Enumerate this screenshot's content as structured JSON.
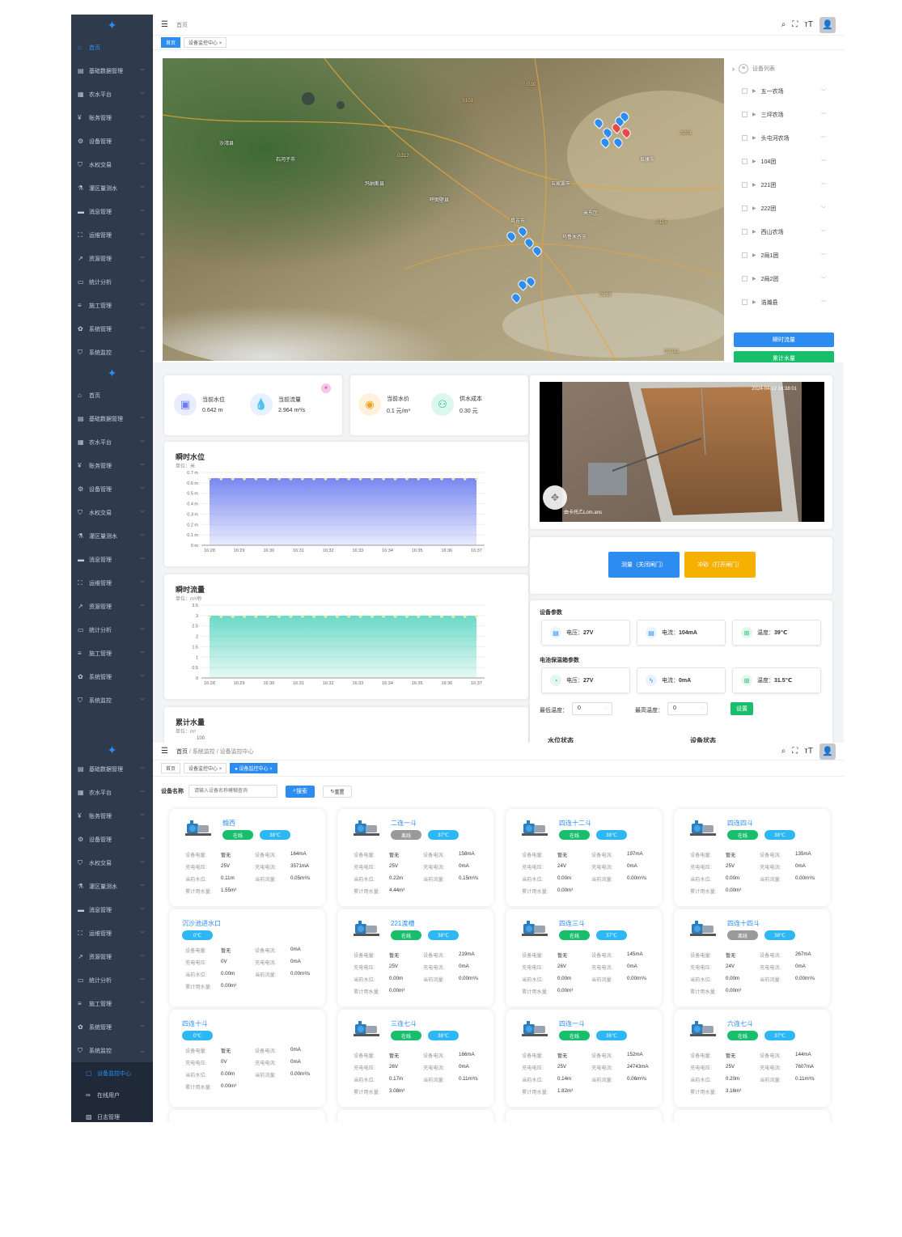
{
  "sidebar_menu": [
    "基础数据管理",
    "农水平台",
    "账务管理",
    "设备管理",
    "水权交易",
    "灌区量测水",
    "消息管理",
    "运维管理",
    "资源管理",
    "统计分析",
    "施工管理",
    "系统管理",
    "系统监控"
  ],
  "sidebar_home": "首页",
  "sidebar_sub": [
    "设备监控中心",
    "在线用户",
    "日志管理"
  ],
  "s1": {
    "crumb": "首页",
    "tags": [
      "首页",
      "设备监控中心"
    ],
    "device_list_title": "设备列表",
    "device_list": [
      "五一农场",
      "三坪农场",
      "头屯河农场",
      "104团",
      "221团",
      "222团",
      "西山农场",
      "2局1团",
      "2局2团",
      "浩瀚县"
    ],
    "btn_flow": "瞬时流量",
    "btn_total": "累计水量",
    "map_labels": [
      "乌鲁木齐市",
      "昌吉市",
      "五家渠市",
      "阜康市",
      "米东区",
      "呼图壁县",
      "玛纳斯县",
      "石河子市",
      "沙湾县",
      "G312",
      "G30",
      "G216",
      "S101",
      "S115",
      "S201",
      "G3033"
    ]
  },
  "s2": {
    "metrics": [
      {
        "label": "当前水位",
        "value": "0.642 m"
      },
      {
        "label": "当前流量",
        "value": "2.964 m³/s"
      },
      {
        "label": "当前水价",
        "value": "0.1 元/m³"
      },
      {
        "label": "供水成本",
        "value": "0.30 元"
      }
    ],
    "video_timestamp": "2024-04-12 16:38:01",
    "video_caption": "由卡托乙Lom.ans",
    "btn_measure": "测量（关闭闸门）",
    "btn_flush": "冲砂（打开闸门）",
    "device_params_title": "设备参数",
    "device_params": [
      {
        "label": "电压",
        "value": "27V"
      },
      {
        "label": "电流",
        "value": "104mA"
      },
      {
        "label": "温度",
        "value": "39℃"
      }
    ],
    "battery_title": "电池保温箱参数",
    "battery_params": [
      {
        "label": "电压",
        "value": "27V"
      },
      {
        "label": "电流",
        "value": "0mA"
      },
      {
        "label": "温度",
        "value": "31.5℃"
      }
    ],
    "min_temp_label": "最低温度：",
    "min_temp": "0",
    "max_temp_label": "最高温度：",
    "max_temp": "0",
    "set_btn": "设置",
    "water_status": "水位状态",
    "device_status": "设备状态",
    "total_title": "累计水量",
    "total_unit": "单位：m³",
    "total_tick": "100"
  },
  "chart_data": [
    {
      "type": "area",
      "title": "瞬时水位",
      "unit": "单位：米",
      "x": [
        "16:28",
        "16:29",
        "16:30",
        "16:31",
        "16:32",
        "16:33",
        "16:34",
        "16:35",
        "16:36",
        "16:37"
      ],
      "yticks": [
        "0 m",
        "0.1 m",
        "0.2 m",
        "0.3 m",
        "0.4 m",
        "0.5 m",
        "0.6 m",
        "0.7 m"
      ],
      "ylim": [
        0,
        0.7
      ],
      "values": [
        0.64,
        0.64,
        0.64,
        0.64,
        0.64,
        0.64,
        0.64,
        0.64,
        0.64,
        0.64,
        0.64,
        0.64,
        0.64,
        0.64,
        0.64,
        0.64,
        0.64,
        0.64,
        0.64,
        0.64,
        0.64,
        0.64,
        0.64,
        0.64
      ],
      "color": "#6b7cf0"
    },
    {
      "type": "area",
      "title": "瞬时流量",
      "unit": "单位：m³/秒",
      "x": [
        "16:28",
        "16:29",
        "16:30",
        "16:31",
        "16:32",
        "16:33",
        "16:34",
        "16:35",
        "16:36",
        "16:37"
      ],
      "yticks": [
        "0",
        "0.5",
        "1",
        "1.5",
        "2",
        "2.5",
        "3",
        "3.5"
      ],
      "ylim": [
        0,
        3.5
      ],
      "values": [
        2.97,
        2.96,
        2.95,
        2.96,
        2.96,
        2.97,
        2.96,
        2.96,
        2.97,
        2.96,
        2.96,
        2.96,
        2.97,
        2.96,
        2.96,
        2.97,
        2.96,
        2.96,
        2.96,
        2.97,
        2.96,
        2.96,
        2.96,
        2.96
      ],
      "color": "#5cd6c0"
    }
  ],
  "s3": {
    "crumbs": [
      "首页",
      "系统监控",
      "设备监控中心"
    ],
    "tags": [
      "首页",
      "设备监控中心",
      "设备监控中心"
    ],
    "search_label": "设备名称",
    "search_placeholder": "请输入设备名称模糊查询",
    "search_btn": "搜索",
    "reset_btn": "重置",
    "keys": [
      "设备电量:",
      "设备电流:",
      "充电电压:",
      "充电电流:",
      "当前水位:",
      "当前流量:",
      "累计用水量:"
    ],
    "devices": [
      {
        "name": "翰西",
        "status": "在线",
        "temp": "38℃",
        "power": "暂无",
        "current": "164mA",
        "cv": "25V",
        "cc": "3571mA",
        "level": "0.11m",
        "flow": "0.05m³/s",
        "total": "1.55m³",
        "pump": true
      },
      {
        "name": "二连一斗",
        "status": "离线",
        "temp": "37℃",
        "power": "暂无",
        "current": "158mA",
        "cv": "25V",
        "cc": "0mA",
        "level": "0.22m",
        "flow": "0.15m³/s",
        "total": "4.44m³",
        "pump": true
      },
      {
        "name": "四连十二斗",
        "status": "在线",
        "temp": "38℃",
        "power": "暂无",
        "current": "197mA",
        "cv": "24V",
        "cc": "0mA",
        "level": "0.00m",
        "flow": "0.00m³/s",
        "total": "0.00m³",
        "pump": true
      },
      {
        "name": "四连四斗",
        "status": "在线",
        "temp": "38℃",
        "power": "暂无",
        "current": "135mA",
        "cv": "25V",
        "cc": "0mA",
        "level": "0.00m",
        "flow": "0.00m³/s",
        "total": "0.00m³",
        "pump": true
      },
      {
        "name": "沉沙池进水口",
        "status": "",
        "temp": "0℃",
        "power": "暂无",
        "current": "0mA",
        "cv": "0V",
        "cc": "0mA",
        "level": "0.00m",
        "flow": "0.00m³/s",
        "total": "0.00m³",
        "pump": false
      },
      {
        "name": "221渡槽",
        "status": "在线",
        "temp": "38℃",
        "power": "暂无",
        "current": "219mA",
        "cv": "25V",
        "cc": "0mA",
        "level": "0.00m",
        "flow": "0.00m³/s",
        "total": "0.00m³",
        "pump": true
      },
      {
        "name": "四连三斗",
        "status": "在线",
        "temp": "37℃",
        "power": "暂无",
        "current": "145mA",
        "cv": "26V",
        "cc": "0mA",
        "level": "0.00m",
        "flow": "0.00m³/s",
        "total": "0.00m³",
        "pump": true
      },
      {
        "name": "四连十四斗",
        "status": "离线",
        "temp": "38℃",
        "power": "暂无",
        "current": "267mA",
        "cv": "24V",
        "cc": "0mA",
        "level": "0.00m",
        "flow": "0.00m³/s",
        "total": "0.00m³",
        "pump": true
      },
      {
        "name": "四连十斗",
        "status": "",
        "temp": "0℃",
        "power": "暂无",
        "current": "0mA",
        "cv": "0V",
        "cc": "0mA",
        "level": "0.00m",
        "flow": "0.00m³/s",
        "total": "0.00m³",
        "pump": false
      },
      {
        "name": "三连七斗",
        "status": "在线",
        "temp": "38℃",
        "power": "暂无",
        "current": "166mA",
        "cv": "26V",
        "cc": "0mA",
        "level": "0.17m",
        "flow": "0.11m³/s",
        "total": "3.08m³",
        "pump": true
      },
      {
        "name": "四连一斗",
        "status": "在线",
        "temp": "36℃",
        "power": "暂无",
        "current": "152mA",
        "cv": "25V",
        "cc": "24743mA",
        "level": "0.14m",
        "flow": "0.06m³/s",
        "total": "1.82m³",
        "pump": true
      },
      {
        "name": "六连七斗",
        "status": "在线",
        "temp": "37℃",
        "power": "暂无",
        "current": "144mA",
        "cv": "25V",
        "cc": "7607mA",
        "level": "0.20m",
        "flow": "0.11m³/s",
        "total": "3.16m³",
        "pump": true
      }
    ]
  }
}
